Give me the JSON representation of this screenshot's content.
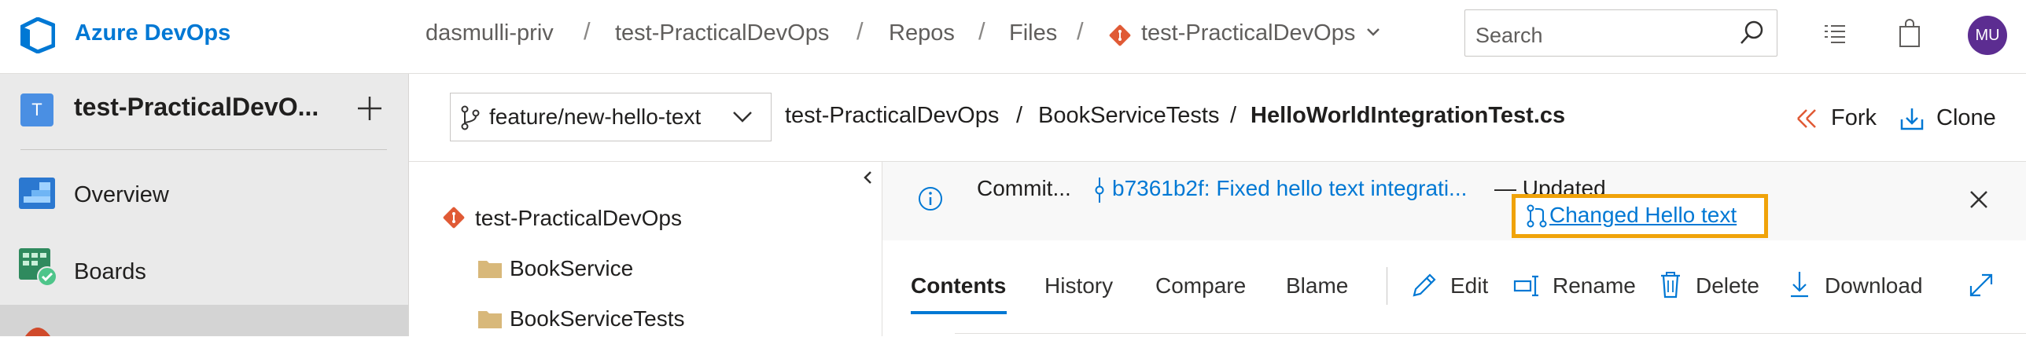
{
  "topbar": {
    "brand": "Azure DevOps",
    "breadcrumbs": [
      "dasmulli-priv",
      "test-PracticalDevOps",
      "Repos",
      "Files",
      "test-PracticalDevOps"
    ],
    "separator": "/",
    "search_placeholder": "Search",
    "avatar_initials": "MU"
  },
  "sidebar": {
    "project_initial": "T",
    "project_name": "test-PracticalDevO...",
    "items": [
      {
        "label": "Overview",
        "icon": "overview-icon"
      },
      {
        "label": "Boards",
        "icon": "boards-icon"
      },
      {
        "label": "",
        "icon": "repos-icon"
      }
    ]
  },
  "path_bar": {
    "branch": "feature/new-hello-text",
    "path": [
      "test-PracticalDevOps",
      "BookServiceTests",
      "HelloWorldIntegrationTest.cs"
    ],
    "separator": "/",
    "fork_label": "Fork",
    "clone_label": "Clone"
  },
  "tree": {
    "root": "test-PracticalDevOps",
    "folders": [
      "BookService",
      "BookServiceTests"
    ]
  },
  "commit_banner": {
    "prefix": "Commit...",
    "commit": "b7361b2f: Fixed hello text integrati...",
    "updated": "— Updated",
    "pull_request": "Changed Hello text"
  },
  "file_view": {
    "tabs": [
      "Contents",
      "History",
      "Compare",
      "Blame"
    ],
    "active_tab": "Contents",
    "actions": [
      "Edit",
      "Rename",
      "Delete",
      "Download"
    ]
  },
  "colors": {
    "accent": "#0078d4",
    "highlight": "#f0a30a",
    "git": "#e05a35",
    "avatar": "#5c2d91"
  }
}
